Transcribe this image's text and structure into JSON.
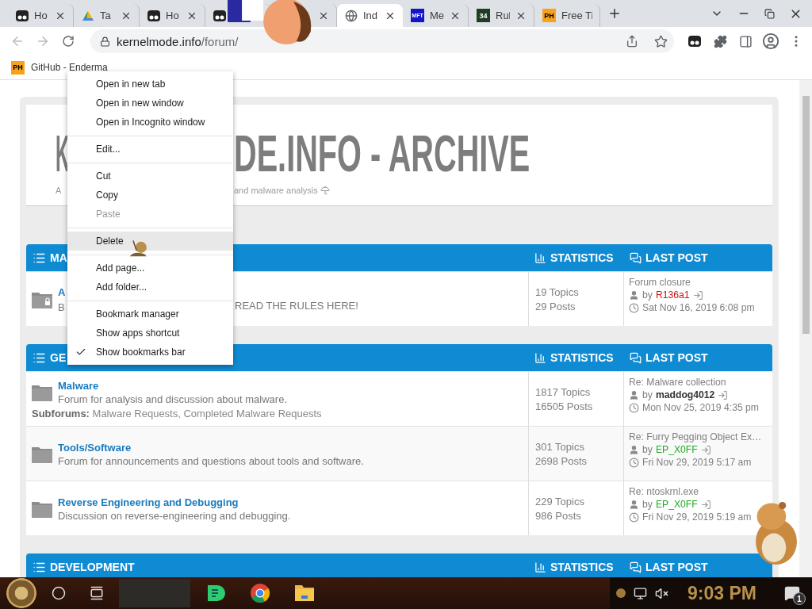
{
  "tabs": [
    {
      "title": "Ho",
      "kind": "pair",
      "closable": true,
      "selected": false
    },
    {
      "title": "Ta",
      "kind": "triangle",
      "closable": true,
      "selected": false
    },
    {
      "title": "Ho",
      "kind": "pair",
      "closable": true,
      "selected": false
    },
    {
      "kind": "pair",
      "selected": false
    },
    {
      "closable": true,
      "selected": false
    },
    {
      "title": "Ind",
      "kind": "globe",
      "closable": true,
      "selected": true
    },
    {
      "title": "Me",
      "kind": "badge",
      "icon_text": "MFT",
      "color": "#1414c8",
      "closable": true,
      "selected": false
    },
    {
      "title": "Rul",
      "kind": "badge",
      "icon_text": "34",
      "color": "#1f3d22",
      "closable": true,
      "selected": false
    },
    {
      "title": "Free Ti",
      "kind": "badge",
      "icon_text": "PH",
      "color": "#f7a21b",
      "closable": false,
      "selected": false
    }
  ],
  "address": {
    "host": "kernelmode.info",
    "path": "/forum/"
  },
  "bookmarks": [
    {
      "icon_text": "PH",
      "label": "GitHub - Enderma"
    }
  ],
  "site": {
    "title_parts": [
      "K",
      "DE.INFO - ARCHIVE"
    ],
    "subtitle_parts": [
      "A",
      "and malware analysis"
    ]
  },
  "sections": [
    {
      "title": "MA",
      "stats_label": "STATISTICS",
      "last_post_label": "LAST POST",
      "forums": [
        {
          "name": "A",
          "description": "B",
          "description_tail": "READ THE RULES HERE!",
          "locked": true,
          "topics": "19 Topics",
          "posts": "29 Posts",
          "last_post": {
            "title": "Forum closure",
            "by": "by",
            "author": "R136a1",
            "color": "#cc1111",
            "bold": false,
            "date": "Sat Nov 16, 2019 6:08 pm"
          }
        }
      ]
    },
    {
      "title": "GE",
      "stats_label": "STATISTICS",
      "last_post_label": "LAST POST",
      "forums": [
        {
          "name": "Malware",
          "description": "Forum for analysis and discussion about malware.",
          "subforums": "**Subforums:** Malware Requests, Completed Malware Requests",
          "locked": false,
          "topics": "1817 Topics",
          "posts": "16505 Posts",
          "last_post": {
            "title": "Re: Malware collection",
            "by": "by",
            "author": "maddog4012",
            "color": "#333333",
            "bold": true,
            "date": "Mon Nov 25, 2019 4:35 pm"
          }
        },
        {
          "name": "Tools/Software",
          "description": "Forum for announcements and questions about tools and software.",
          "locked": false,
          "topics": "301 Topics",
          "posts": "2698 Posts",
          "last_post": {
            "title": "Re: Furry Pegging Object Ex…",
            "by": "by",
            "author": "EP_X0FF",
            "color": "#22aa22",
            "bold": false,
            "date": "Fri Nov 29, 2019 5:17 am"
          }
        },
        {
          "name": "Reverse Engineering and Debugging",
          "description": "Discussion on reverse-engineering and debugging.",
          "locked": false,
          "topics": "229 Topics",
          "posts": "986 Posts",
          "last_post": {
            "title": "Re: ntoskrnl.exe",
            "by": "by",
            "author": "EP_X0FF",
            "color": "#22aa22",
            "bold": false,
            "date": "Fri Nov 29, 2019 5:19 am"
          }
        }
      ]
    },
    {
      "title": "DEVELOPMENT",
      "stats_label": "STATISTICS",
      "last_post_label": "LAST POST"
    }
  ],
  "context_menu": {
    "groups": [
      {
        "items": [
          {
            "label": "Open in new tab",
            "checked": false,
            "disabled": false,
            "selected": false
          },
          {
            "label": "Open in new window",
            "checked": false,
            "disabled": false,
            "selected": false
          },
          {
            "label": "Open in Incognito window",
            "checked": false,
            "disabled": false,
            "selected": false
          }
        ]
      },
      {
        "items": [
          {
            "label": "Edit...",
            "checked": false,
            "disabled": false,
            "selected": false
          }
        ]
      },
      {
        "items": [
          {
            "label": "Cut",
            "checked": false,
            "disabled": false,
            "selected": false
          },
          {
            "label": "Copy",
            "checked": false,
            "disabled": false,
            "selected": false
          },
          {
            "label": "Paste",
            "checked": false,
            "disabled": true,
            "selected": false
          }
        ]
      },
      {
        "items": [
          {
            "label": "Delete",
            "checked": false,
            "disabled": false,
            "selected": true
          }
        ]
      },
      {
        "items": [
          {
            "label": "Add page...",
            "checked": false,
            "disabled": false,
            "selected": false
          },
          {
            "label": "Add folder...",
            "checked": false,
            "disabled": false,
            "selected": false
          }
        ]
      },
      {
        "items": [
          {
            "label": "Bookmark manager",
            "checked": false,
            "disabled": false,
            "selected": false
          },
          {
            "label": "Show apps shortcut",
            "checked": false,
            "disabled": false,
            "selected": false
          },
          {
            "label": "Show bookmarks bar",
            "checked": true,
            "disabled": false,
            "selected": false
          }
        ]
      }
    ]
  },
  "taskbar": {
    "clock": "9:03 PM",
    "notification_count": "1"
  }
}
